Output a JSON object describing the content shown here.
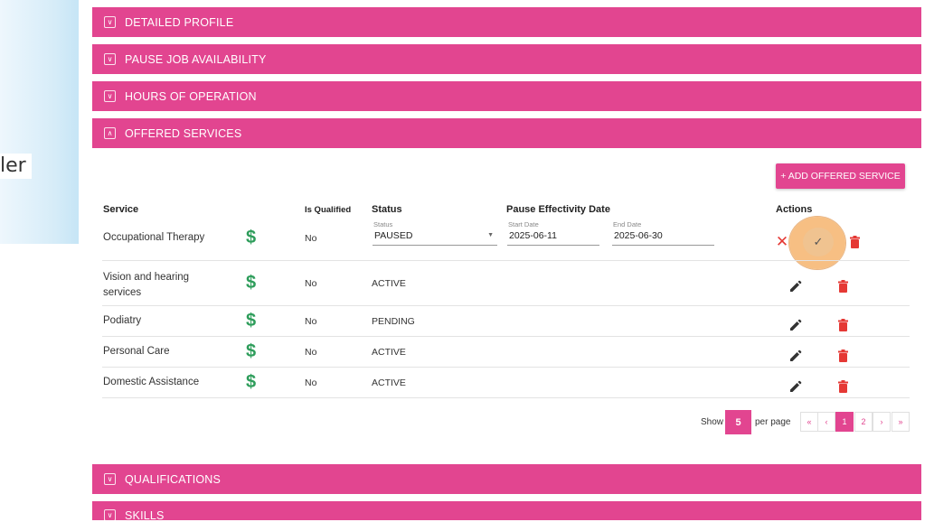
{
  "left": {
    "text": "ler"
  },
  "accordions": {
    "detailed_profile": "DETAILED PROFILE",
    "pause_job": "PAUSE JOB AVAILABILITY",
    "hours": "HOURS OF OPERATION",
    "offered_services": "OFFERED SERVICES",
    "qualifications": "QUALIFICATIONS",
    "skills": "SKILLS"
  },
  "add_button": "+ ADD OFFERED SERVICE",
  "table": {
    "headers": {
      "service": "Service",
      "is_qualified": "Is Qualified",
      "status": "Status",
      "pause_date": "Pause Effectivity Date",
      "actions": "Actions"
    },
    "rows": [
      {
        "service": "Occupational Therapy",
        "qualified": "No",
        "status": "PAUSED"
      },
      {
        "service": "Vision and hearing services",
        "qualified": "No",
        "status": "ACTIVE"
      },
      {
        "service": "Podiatry",
        "qualified": "No",
        "status": "PENDING"
      },
      {
        "service": "Personal Care",
        "qualified": "No",
        "status": "ACTIVE"
      },
      {
        "service": "Domestic Assistance",
        "qualified": "No",
        "status": "ACTIVE"
      }
    ],
    "edit": {
      "status_label": "Status",
      "status_value": "PAUSED",
      "start_label": "Start Date",
      "start_value": "2025-06-11",
      "end_label": "End Date",
      "end_value": "2025-06-30"
    }
  },
  "pager": {
    "show": "Show",
    "size": "5",
    "per_page": "per page",
    "first": "«",
    "prev": "‹",
    "pages": [
      "1",
      "2"
    ],
    "next": "›",
    "last": "»"
  },
  "colors": {
    "accent": "#e24590",
    "dollar": "#2e9d5b",
    "delete": "#e53935"
  },
  "icons": [
    "chevron-down-icon",
    "chevron-up-icon",
    "dollar-icon",
    "pencil-icon",
    "trash-icon",
    "close-icon",
    "check-icon"
  ]
}
